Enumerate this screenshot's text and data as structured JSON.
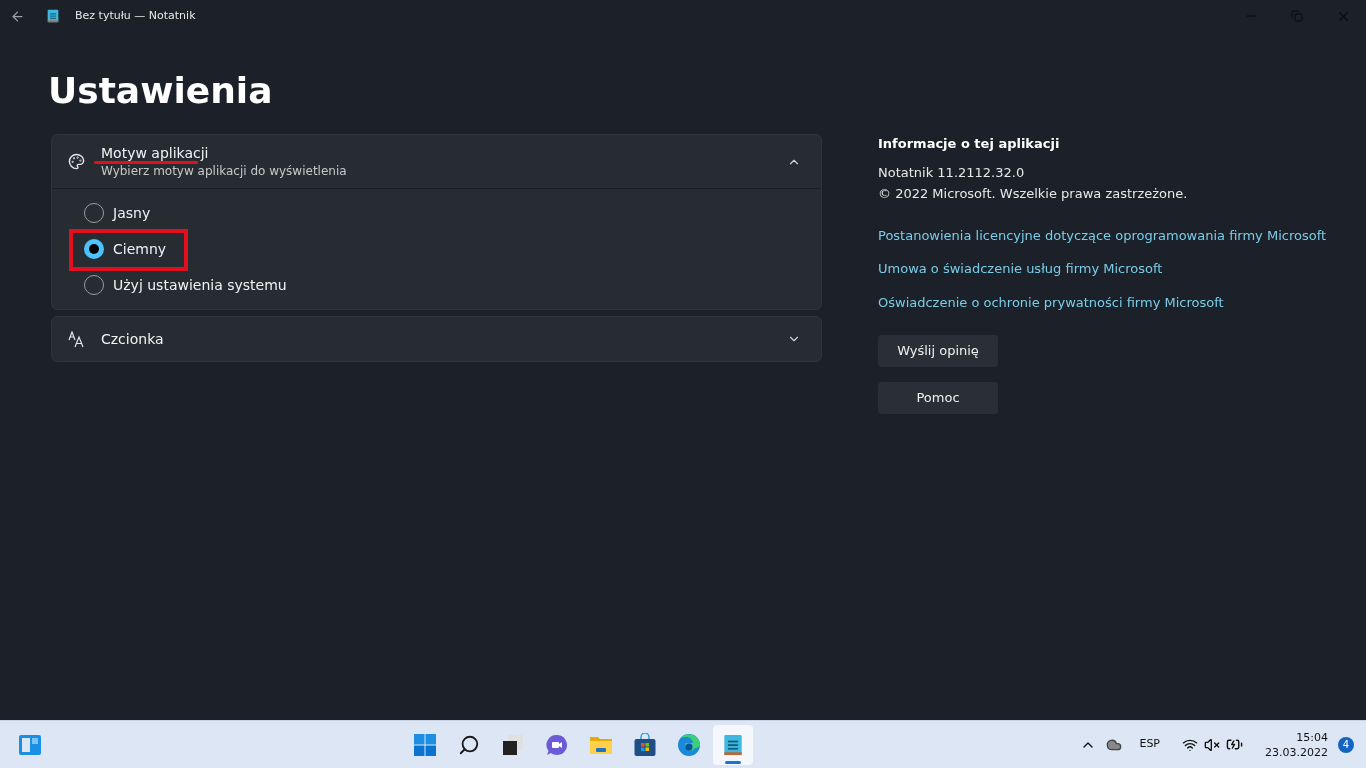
{
  "window": {
    "title": "Bez tytułu — Notatnik"
  },
  "page_title": "Ustawienia",
  "sections": [
    {
      "kind": "radio",
      "title": "Motyw aplikacji",
      "subtitle": "Wybierz motyw aplikacji do wyświetlenia",
      "expanded": true,
      "underlined": true,
      "options": [
        {
          "label": "Jasny",
          "selected": false,
          "highlighted": false
        },
        {
          "label": "Ciemny",
          "selected": true,
          "highlighted": true
        },
        {
          "label": "Użyj ustawienia systemu",
          "selected": false,
          "highlighted": false
        }
      ]
    },
    {
      "kind": "font",
      "title": "Czcionka",
      "expanded": false,
      "underlined": false
    }
  ],
  "about": {
    "heading": "Informacje o tej aplikacji",
    "version": "Notatnik 11.2112.32.0",
    "copyright": "© 2022 Microsoft. Wszelkie prawa zastrzeżone.",
    "links": [
      "Postanowienia licencyjne dotyczące oprogramowania firmy Microsoft",
      "Umowa o świadczenie usług firmy Microsoft",
      "Oświadczenie o ochronie prywatności firmy Microsoft"
    ],
    "buttons": [
      "Wyślij opinię",
      "Pomoc"
    ]
  },
  "taskbar": {
    "apps": [
      {
        "kind": "start",
        "selected": false
      },
      {
        "kind": "search",
        "selected": false
      },
      {
        "kind": "taskview",
        "selected": false
      },
      {
        "kind": "chat",
        "selected": false
      },
      {
        "kind": "explorer",
        "selected": false
      },
      {
        "kind": "store",
        "selected": false
      },
      {
        "kind": "edge",
        "selected": false
      },
      {
        "kind": "notepad",
        "selected": true
      }
    ],
    "language": "ESP",
    "time": "15:04",
    "date": "23.03.2022",
    "notifications": "4"
  }
}
